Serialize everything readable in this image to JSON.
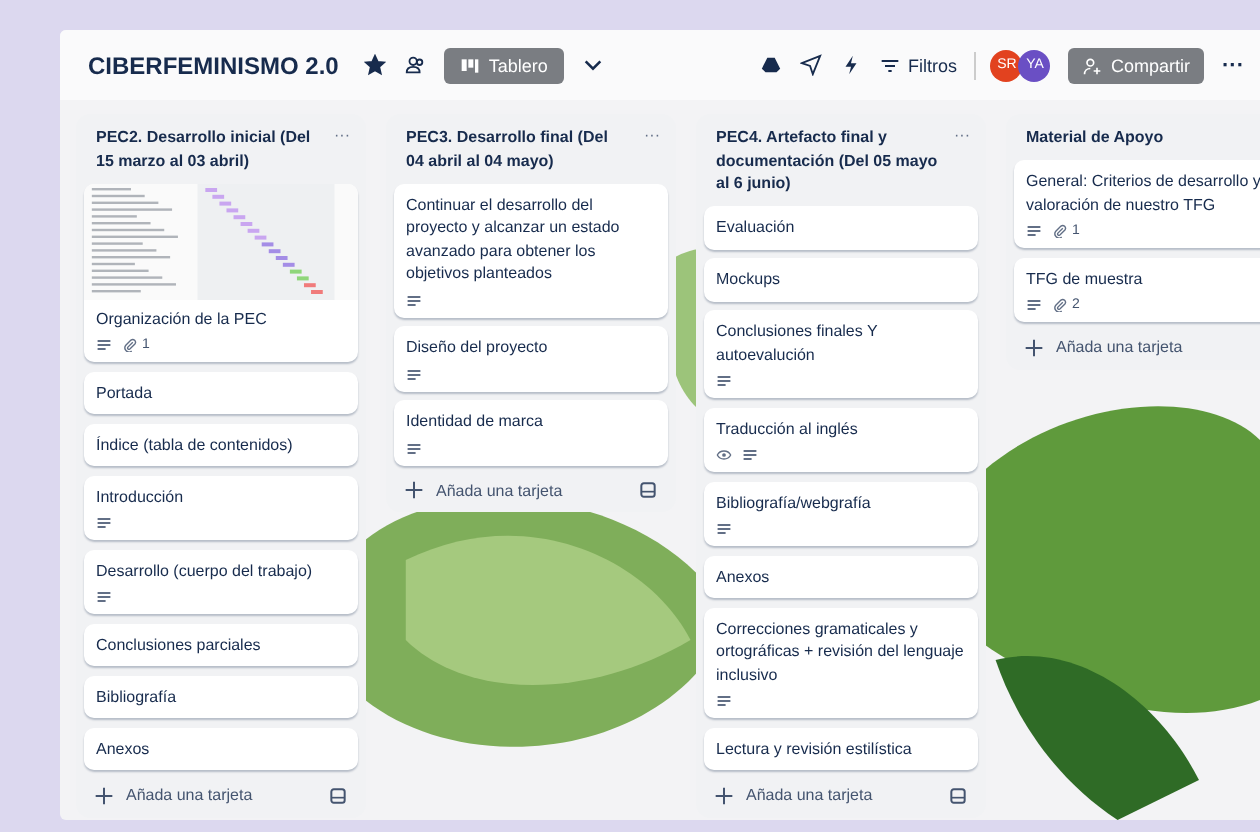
{
  "board": {
    "title": "CIBERFEMINISMO 2.0",
    "starred": true,
    "view_button": "Tablero",
    "filter_button": "Filtros",
    "members": [
      {
        "initials": "SR",
        "color": "#e2421f"
      },
      {
        "initials": "YA",
        "color": "#6a4fc4"
      }
    ],
    "share_button": "Compartir",
    "more": "···"
  },
  "lists": [
    {
      "title": "PEC2. Desarrollo inicial (Del 15 marzo al 03 abril)",
      "menu": "···",
      "add_card": "Añada una tarjeta",
      "cards": [
        {
          "title": "Organización de la PEC",
          "cover": true,
          "badges": [
            {
              "kind": "description"
            },
            {
              "kind": "attachments",
              "count": "1"
            }
          ]
        },
        {
          "title": "Portada"
        },
        {
          "title": "Índice (tabla de contenidos)"
        },
        {
          "title": "Introducción",
          "badges": [
            {
              "kind": "description"
            }
          ]
        },
        {
          "title": "Desarrollo (cuerpo del trabajo)",
          "badges": [
            {
              "kind": "description"
            }
          ]
        },
        {
          "title": "Conclusiones parciales"
        },
        {
          "title": "Bibliografía"
        },
        {
          "title": "Anexos"
        }
      ]
    },
    {
      "title": "PEC3. Desarrollo final (Del 04 abril al 04 mayo)",
      "menu": "···",
      "add_card": "Añada una tarjeta",
      "cards": [
        {
          "title": "Continuar el desarrollo del proyecto y alcanzar un estado avanzado para obtener los objetivos planteados",
          "badges": [
            {
              "kind": "description"
            }
          ]
        },
        {
          "title": "Diseño del proyecto",
          "badges": [
            {
              "kind": "description"
            }
          ]
        },
        {
          "title": "Identidad de marca",
          "badges": [
            {
              "kind": "description"
            }
          ]
        }
      ]
    },
    {
      "title": "PEC4. Artefacto final y documentación (Del 05 mayo al 6 junio)",
      "menu": "···",
      "add_card": "Añada una tarjeta",
      "cards": [
        {
          "title": "Evaluación"
        },
        {
          "title": "Mockups"
        },
        {
          "title": "Conclusiones finales Y autoevalución",
          "badges": [
            {
              "kind": "description"
            }
          ]
        },
        {
          "title": "Traducción al inglés",
          "badges": [
            {
              "kind": "watch"
            },
            {
              "kind": "description"
            }
          ]
        },
        {
          "title": "Bibliografía/webgrafía",
          "badges": [
            {
              "kind": "description"
            }
          ]
        },
        {
          "title": "Anexos"
        },
        {
          "title": "Correcciones gramaticales y ortográficas + revisión del lenguaje inclusivo",
          "badges": [
            {
              "kind": "description"
            }
          ]
        },
        {
          "title": "Lectura y revisión estilística"
        }
      ]
    },
    {
      "title": "Material de Apoyo",
      "add_card": "Añada una tarjeta",
      "cards": [
        {
          "title": "General: Criterios de desarrollo y valoración de nuestro TFG",
          "badges": [
            {
              "kind": "description"
            },
            {
              "kind": "attachments",
              "count": "1"
            }
          ]
        },
        {
          "title": "TFG de muestra",
          "badges": [
            {
              "kind": "description"
            },
            {
              "kind": "attachments",
              "count": "2"
            }
          ]
        }
      ]
    }
  ]
}
